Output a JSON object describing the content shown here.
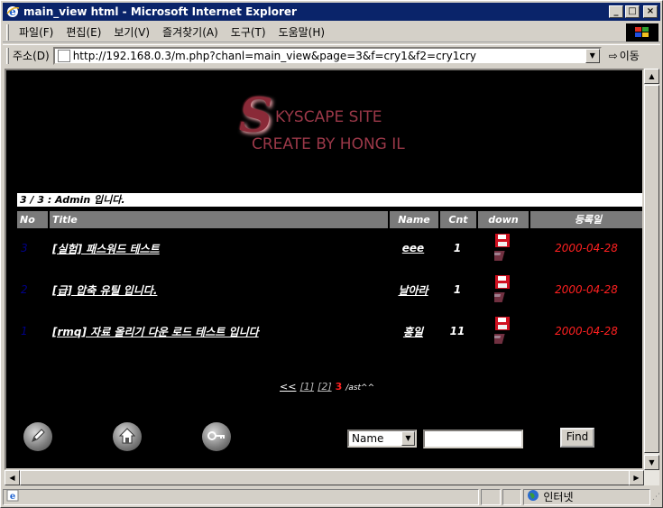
{
  "window": {
    "title": "main_view html - Microsoft Internet Explorer",
    "min_glyph": "_",
    "max_glyph": "□",
    "close_glyph": "×"
  },
  "menu": [
    "파일(F)",
    "편집(E)",
    "보기(V)",
    "즐겨찾기(A)",
    "도구(T)",
    "도움말(H)"
  ],
  "address": {
    "label": "주소(D)",
    "url": "http://192.168.0.3/m.php?chanl=main_view&page=3&f=cry1&f2=cry1cry",
    "go_label": "이동"
  },
  "page": {
    "logo": {
      "initial": "S",
      "line1": "KYSCAPE SITE",
      "line2": "CREATE BY HONG IL"
    },
    "info": "3 / 3 : Admin 입니다.",
    "columns": [
      "No",
      "Title",
      "Name",
      "Cnt",
      "down",
      "등록일"
    ],
    "rows": [
      {
        "no": "3",
        "title": "[실험] 패스워드 테스트",
        "name": "eee",
        "cnt": "1",
        "date": "2000-04-28"
      },
      {
        "no": "2",
        "title": "[급] 압축 유틸 입니다.",
        "name": "날아라",
        "cnt": "1",
        "date": "2000-04-28"
      },
      {
        "no": "1",
        "title": "[rmq] 자료 올리기 다운 로드 테스트 입니다",
        "name": "홍일",
        "cnt": "11",
        "date": "2000-04-28"
      }
    ],
    "pager": {
      "prev": "<<",
      "pages": [
        "[1]",
        "[2]"
      ],
      "current": "3",
      "suffix": "/ast^^"
    },
    "search": {
      "select_value": "Name",
      "find_label": "Find"
    }
  },
  "status": {
    "zone": "인터넷"
  },
  "colors": {
    "titlebar": "#0a246a",
    "date": "#ff2020",
    "header_cell": "#7a7a7a"
  }
}
